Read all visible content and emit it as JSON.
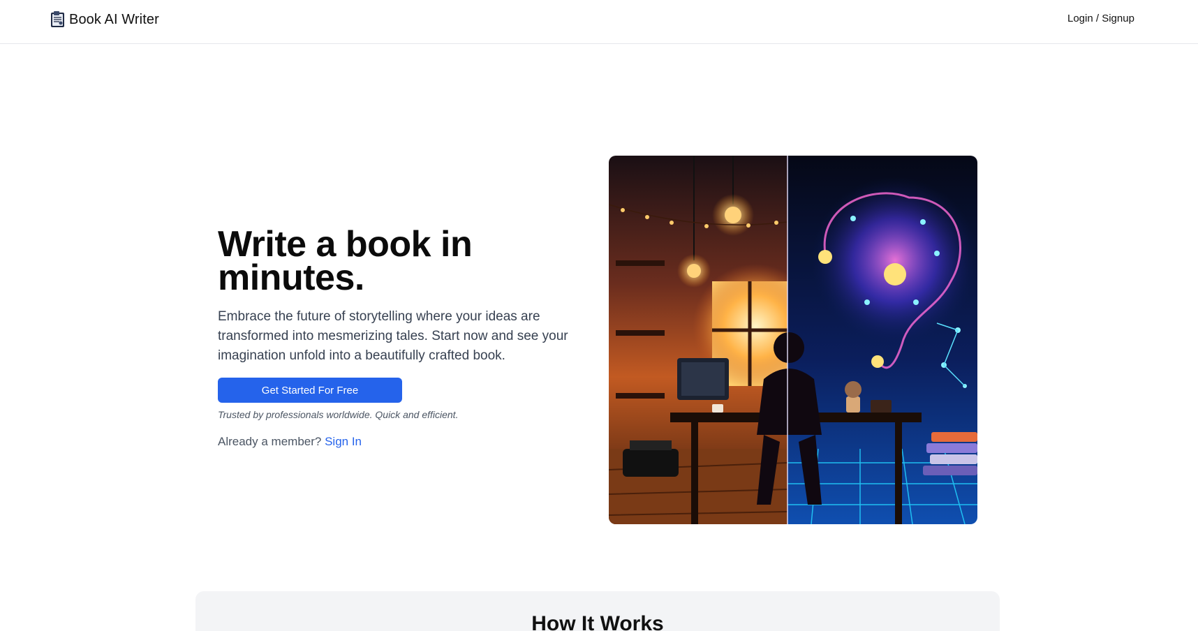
{
  "header": {
    "brand_name": "Book AI Writer",
    "brand_icon": "book-logo-icon",
    "login_label": "Login / Signup"
  },
  "hero": {
    "title_line1": "Write a book in",
    "title_line2": "minutes.",
    "description": "Embrace the future of storytelling where your ideas are transformed into mesmerizing tales. Start now and see your imagination unfold into a beautifully crafted book.",
    "cta_label": "Get Started For Free",
    "trust_note": "Trusted by professionals worldwide. Quick and efficient.",
    "member_prompt": "Already a member?",
    "signin_label": "Sign In"
  },
  "how_it_works": {
    "title": "How It Works"
  },
  "colors": {
    "primary": "#2563eb",
    "text": "#111111",
    "muted": "#4b5563",
    "section_bg": "#f3f4f6"
  }
}
